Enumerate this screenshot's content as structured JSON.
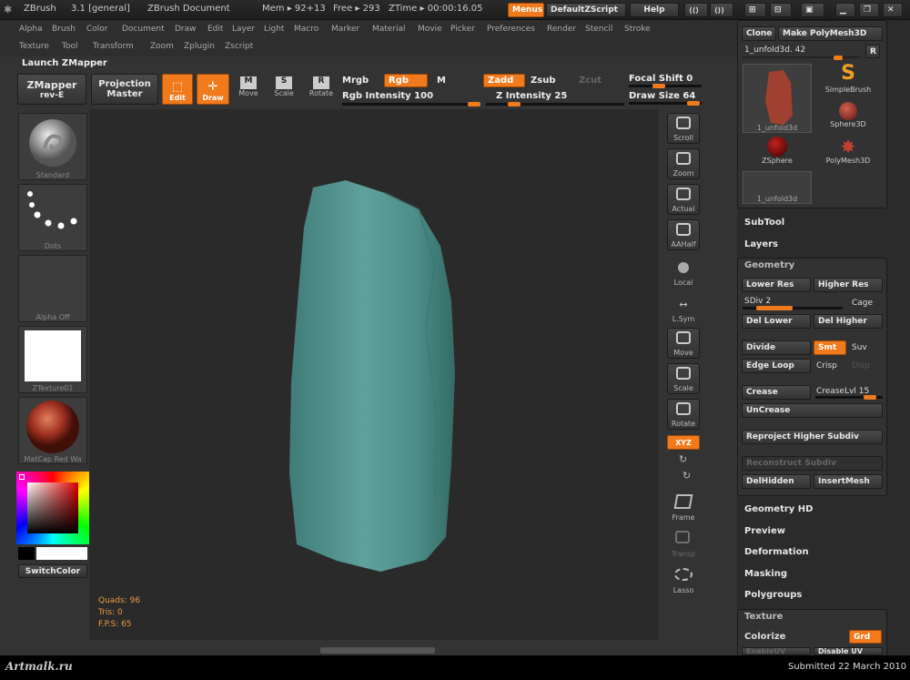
{
  "titlebar": {
    "app_name": "ZBrush",
    "version": "3.1 [general]",
    "document": "ZBrush Document",
    "mem": "Mem ▸ 92+13",
    "free": "Free ▸ 293",
    "ztime": "ZTime ▸ 00:00:16.05",
    "menus_btn": "Menus",
    "zscript_btn": "DefaultZScript",
    "help_btn": "Help"
  },
  "menu": {
    "row1": [
      "Alpha",
      "Brush",
      "Color",
      "Document",
      "Draw",
      "Edit",
      "Layer",
      "Light",
      "Macro",
      "Marker",
      "Material",
      "Movie",
      "Picker",
      "Preferences",
      "Render",
      "Stencil",
      "Stroke"
    ],
    "row2": [
      "Texture",
      "Tool",
      "Transform",
      "Zoom",
      "Zplugin",
      "Zscript"
    ]
  },
  "toolbar": {
    "launch": "Launch ZMapper",
    "zmapper": "ZMapper",
    "zmapper_sub": "rev-E",
    "projection": "Projection",
    "projection_sub": "Master",
    "edit": "Edit",
    "draw": "Draw",
    "move": "Move",
    "scale": "Scale",
    "rotate": "Rotate",
    "mrgb": "Mrgb",
    "rgb": "Rgb",
    "m": "M",
    "rgb_intensity": "Rgb Intensity 100",
    "zadd": "Zadd",
    "zsub": "Zsub",
    "zcut": "Zcut",
    "z_intensity": "Z Intensity 25",
    "focal_shift": "Focal Shift 0",
    "draw_size": "Draw Size 64",
    "rgb_intensity_value": 1.0,
    "z_intensity_value": 0.25,
    "focal_shift_value": 0.5,
    "draw_size_value": 0.98
  },
  "left_shelf": {
    "standard": "Standard",
    "dots": "Dots",
    "alpha": "Alpha Off",
    "texture": "ZTexture01",
    "matcap": "MatCap Red Wa",
    "switch_color": "SwitchColor"
  },
  "stats": {
    "quads": "Quads: 96",
    "tris": "Tris: 0",
    "fps": "F.P.S: 65"
  },
  "right_shelf": [
    "Scroll",
    "Zoom",
    "Actual",
    "AAHalf",
    "Local",
    "L.Sym",
    "Move",
    "Scale",
    "Rotate",
    "XYZ",
    "Frame",
    "Transp",
    "Lasso"
  ],
  "tool_panel": {
    "clone": "Clone",
    "make_polymesh": "Make PolyMesh3D",
    "current_tool": "1_unfold3d. 42",
    "r_btn": "R",
    "items": [
      "1_unfold3d",
      "SimpleBrush",
      "Sphere3D",
      "ZSphere",
      "PolyMesh3D",
      "1_unfold3d"
    ]
  },
  "panels": {
    "subtool": "SubTool",
    "layers": "Layers",
    "geometry": "Geometry",
    "lower_res": "Lower Res",
    "higher_res": "Higher Res",
    "sdiv": "SDiv 2",
    "cage": "Cage",
    "del_lower": "Del Lower",
    "del_higher": "Del Higher",
    "divide": "Divide",
    "smt": "Smt",
    "suv": "Suv",
    "edge_loop": "Edge Loop",
    "crisp": "Crisp",
    "disp": "Disp",
    "crease": "Crease",
    "crease_lvl": "CreaseLvl 15",
    "uncrease": "UnCrease",
    "reproject": "Reproject Higher Subdiv",
    "reconstruct": "Reconstruct Subdiv",
    "del_hidden": "DelHidden",
    "insert_mesh": "InsertMesh",
    "geometry_hd": "Geometry HD",
    "preview": "Preview",
    "deformation": "Deformation",
    "masking": "Masking",
    "polygroups": "Polygroups",
    "texture": "Texture",
    "colorize": "Colorize",
    "grd": "Grd",
    "enable_uv": "EnableUV",
    "disable_uv": "Disable UV",
    "sdiv_value": 0.5,
    "crease_value": 0.9
  },
  "footer": {
    "logo": "Artmalk.ru",
    "submitted": "Submitted 22 March 2010"
  },
  "colors": {
    "accent": "#f07a1c",
    "mesh": "#5a9a96",
    "background": "#2a2a2a"
  }
}
